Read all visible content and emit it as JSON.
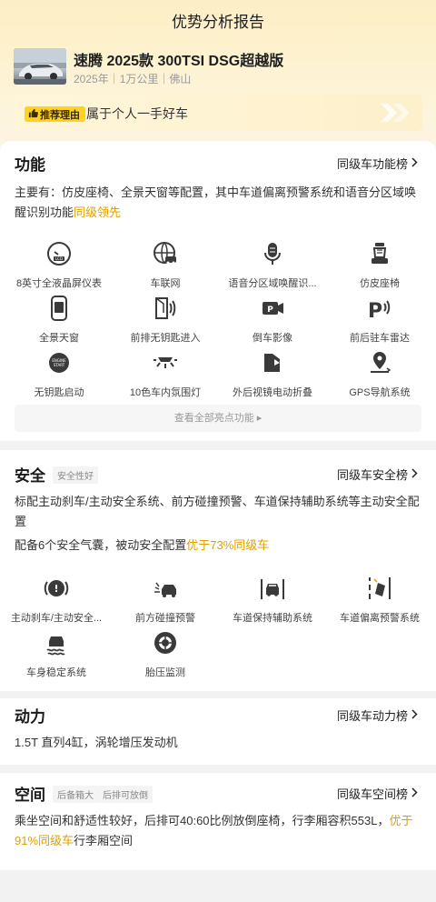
{
  "header": {
    "title": "优势分析报告"
  },
  "car": {
    "name": "速腾 2025款 300TSI DSG超越版",
    "meta": "2025年｜1万公里｜佛山"
  },
  "reason": {
    "badge": "推荐理由",
    "text": "属于个人一手好车"
  },
  "function": {
    "title": "功能",
    "link": "同级车功能榜",
    "desc_prefix": "主要有：仿皮座椅、全景天窗等配置，其中车道偏离预警系统和语音分区域唤醒识别功能",
    "desc_highlight": "同级领先",
    "items": [
      {
        "label": "8英寸全液晶屏仪表",
        "icon": "lcd-gauge-icon"
      },
      {
        "label": "车联网",
        "icon": "connected-car-icon"
      },
      {
        "label": "语音分区域唤醒识...",
        "icon": "microphone-icon"
      },
      {
        "label": "仿皮座椅",
        "icon": "seat-icon"
      },
      {
        "label": "全景天窗",
        "icon": "sunroof-icon"
      },
      {
        "label": "前排无钥匙进入",
        "icon": "keyless-door-icon"
      },
      {
        "label": "倒车影像",
        "icon": "reverse-camera-icon"
      },
      {
        "label": "前后驻车雷达",
        "icon": "parking-radar-icon"
      },
      {
        "label": "无钥匙启动",
        "icon": "engine-start-icon"
      },
      {
        "label": "10色车内氛围灯",
        "icon": "ambient-light-icon"
      },
      {
        "label": "外后视镜电动折叠",
        "icon": "mirror-fold-icon"
      },
      {
        "label": "GPS导航系统",
        "icon": "gps-icon"
      }
    ],
    "view_all": "查看全部亮点功能 ▸"
  },
  "safety": {
    "title": "安全",
    "tag": "安全性好",
    "link": "同级车安全榜",
    "desc1": "标配主动刹车/主动安全系统、前方碰撞预警、车道保持辅助系统等主动安全配置",
    "desc2_prefix": "配备6个安全气囊，被动安全配置",
    "desc2_highlight": "优于73%同级车",
    "items": [
      {
        "label": "主动刹车/主动安全...",
        "icon": "brake-icon"
      },
      {
        "label": "前方碰撞预警",
        "icon": "collision-warning-icon"
      },
      {
        "label": "车道保持辅助系统",
        "icon": "lane-keep-icon"
      },
      {
        "label": "车道偏离预警系统",
        "icon": "lane-departure-icon"
      },
      {
        "label": "车身稳定系统",
        "icon": "stability-icon"
      },
      {
        "label": "胎压监测",
        "icon": "tire-pressure-icon"
      }
    ]
  },
  "power": {
    "title": "动力",
    "link": "同级车动力榜",
    "desc": "1.5T 直列4缸，涡轮增压发动机"
  },
  "space": {
    "title": "空间",
    "tags": [
      "后备箱大",
      "后排可放倒"
    ],
    "link": "同级车空间榜",
    "desc_prefix": "乘坐空间和舒适性较好，后排可40:60比例放倒座椅，行李厢容积553L，",
    "desc_highlight": "优于91%同级车",
    "desc_suffix": "行李厢空间"
  },
  "colors": {
    "highlight": "#e0a100",
    "badge": "#ffd21e",
    "icon": "#3a3a3a"
  }
}
